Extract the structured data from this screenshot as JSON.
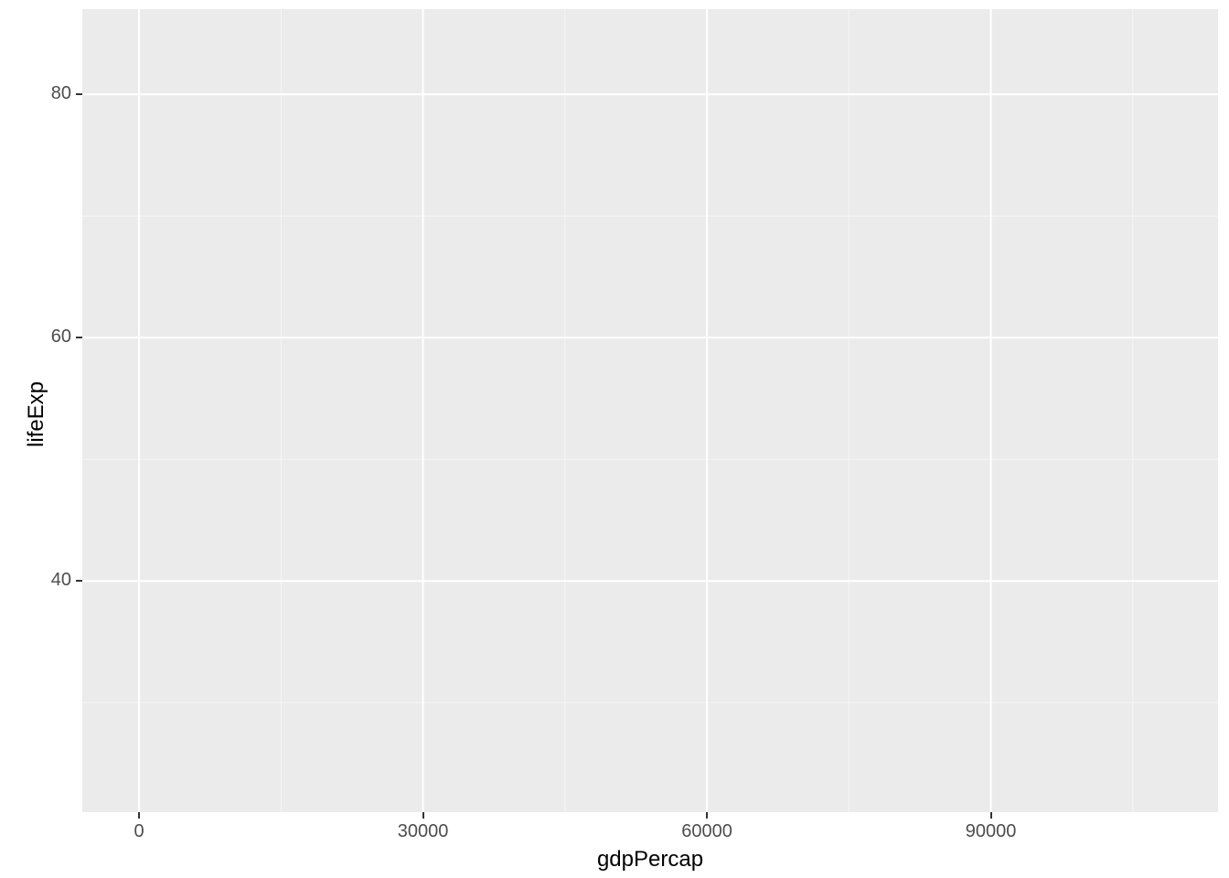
{
  "chart_data": {
    "type": "scatter",
    "title": "",
    "xlabel": "gdpPercap",
    "ylabel": "lifeExp",
    "xlim": [
      -6000,
      114000
    ],
    "ylim": [
      21,
      87
    ],
    "x_ticks": [
      0,
      30000,
      60000,
      90000
    ],
    "y_ticks": [
      40,
      60,
      80
    ],
    "x_minor_ticks": [
      15000,
      45000,
      75000,
      105000
    ],
    "y_minor_ticks": [
      30,
      50,
      70
    ],
    "series": [],
    "panel_bg": "#ebebeb",
    "grid_major_color": "#ffffff",
    "grid_minor_color": "#f5f5f5"
  }
}
